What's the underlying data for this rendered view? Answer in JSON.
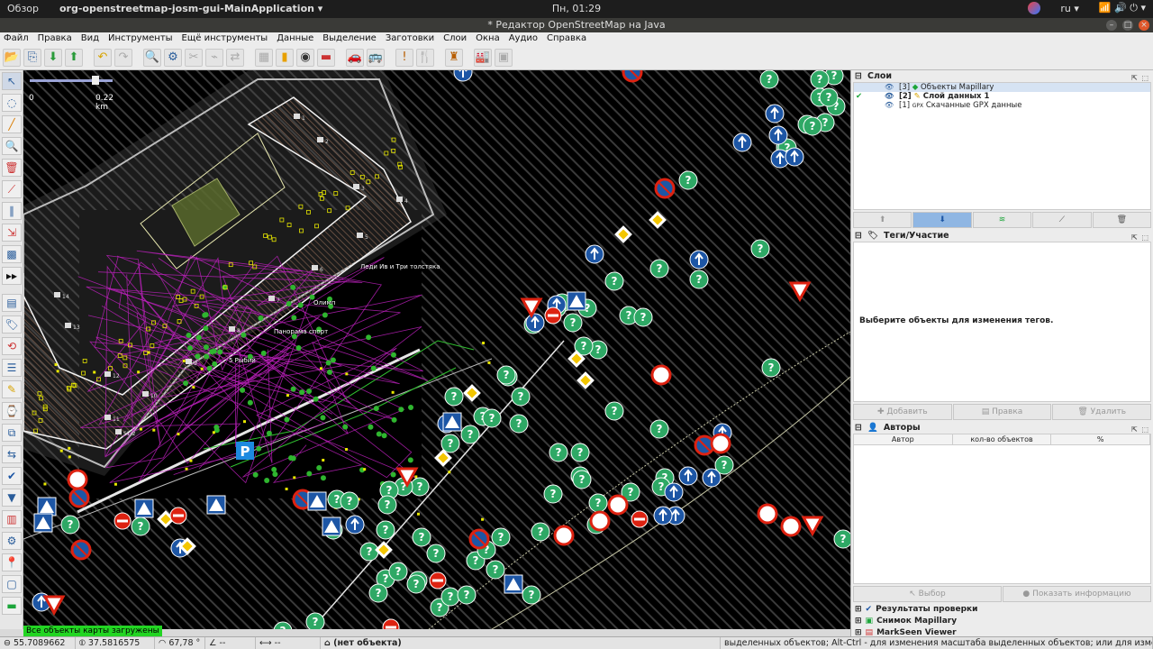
{
  "topbar": {
    "overview": "Обзор",
    "app": "org-openstreetmap-josm-gui-MainApplication",
    "clock": "Пн, 01:29",
    "lang": "ru"
  },
  "window": {
    "title": "* Редактор OpenStreetMap на Java"
  },
  "menu": [
    "Файл",
    "Правка",
    "Вид",
    "Инструменты",
    "Ещё инструменты",
    "Данные",
    "Выделение",
    "Заготовки",
    "Слои",
    "Окна",
    "Аудио",
    "Справка"
  ],
  "map": {
    "scale_zero": "0",
    "scale_km": "0.22 km",
    "loaded_msg": "Все объекты карты загружены",
    "labels": [
      {
        "t": "Леди Ив и Три толстяка"
      },
      {
        "t": "Олимп"
      },
      {
        "t": "Панорама спорт"
      },
      {
        "t": "5 Рыбий"
      }
    ],
    "house_numbers": [
      "1",
      "2",
      "3",
      "4",
      "5",
      "6",
      "7",
      "8",
      "9",
      "10",
      "11",
      "12",
      "13",
      "14",
      "S1/2"
    ]
  },
  "layers_panel": {
    "title": "Слои",
    "items": [
      {
        "num": "[3]",
        "name": "Объекты Mapillary"
      },
      {
        "num": "[2]",
        "name": "Слой данных 1"
      },
      {
        "num": "[1]",
        "name": "Скачанные GPX данные"
      }
    ]
  },
  "tags_panel": {
    "title": "Теги/Участие",
    "empty_msg": "Выберите объекты для изменения тегов.",
    "btn_add": "Добавить",
    "btn_edit": "Правка",
    "btn_delete": "Удалить"
  },
  "authors_panel": {
    "title": "Авторы",
    "col_author": "Автор",
    "col_count": "кол-во объектов",
    "col_pct": "%"
  },
  "mapillary_buttons": {
    "select": "Выбор",
    "show_info": "Показать информацию"
  },
  "collapsed": [
    "Результаты проверки",
    "Снимок Mapillary",
    "MarkSeen Viewer"
  ],
  "status": {
    "lat": "55.7089662",
    "lon": "37.5816575",
    "heading": "67,78 °",
    "angle": "--",
    "dist": "--",
    "obj": "(нет объекта)",
    "hint": "выделенных объектов; Alt-Ctrl - для изменения масштаба выделенных объектов; или для изменения выделе"
  }
}
